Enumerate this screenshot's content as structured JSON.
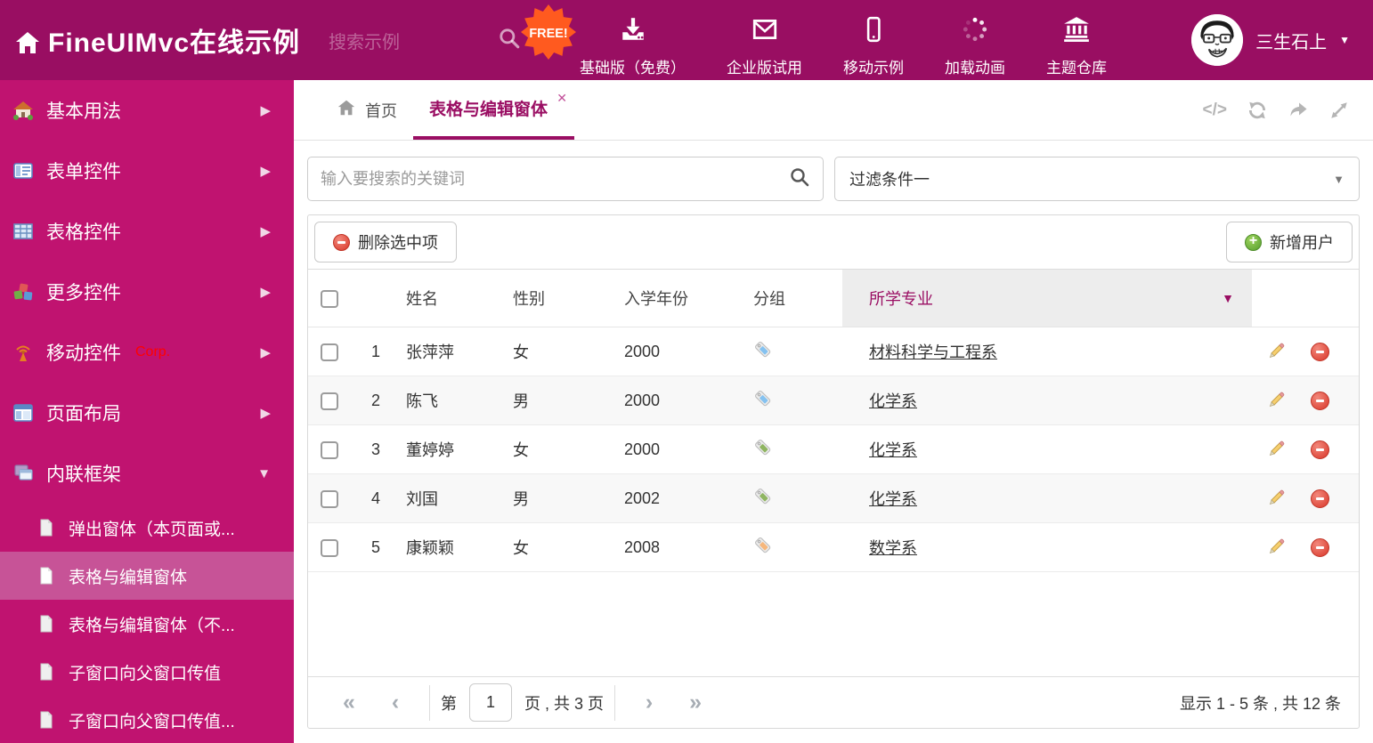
{
  "header": {
    "title": "FineUIMvc在线示例",
    "search_placeholder": "搜索示例",
    "free_badge": "FREE!",
    "nav_items": [
      {
        "icon": "download-icon",
        "label": "基础版（免费）"
      },
      {
        "icon": "envelope-icon",
        "label": "企业版试用"
      },
      {
        "icon": "mobile-icon",
        "label": "移动示例"
      },
      {
        "icon": "spinner-icon",
        "label": "加载动画"
      },
      {
        "icon": "bank-icon",
        "label": "主题仓库"
      }
    ],
    "username": "三生石上"
  },
  "sidebar": {
    "items": [
      {
        "label": "基本用法",
        "icon": "home-icon"
      },
      {
        "label": "表单控件",
        "icon": "form-icon"
      },
      {
        "label": "表格控件",
        "icon": "table-icon"
      },
      {
        "label": "更多控件",
        "icon": "blocks-icon"
      },
      {
        "label": "移动控件",
        "badge": "Corp.",
        "icon": "antenna-icon"
      },
      {
        "label": "页面布局",
        "icon": "layout-icon"
      },
      {
        "label": "内联框架",
        "icon": "frames-icon"
      }
    ],
    "subitems": [
      {
        "label": "弹出窗体（本页面或..."
      },
      {
        "label": "表格与编辑窗体"
      },
      {
        "label": "表格与编辑窗体（不..."
      },
      {
        "label": "子窗口向父窗口传值"
      },
      {
        "label": "子窗口向父窗口传值..."
      }
    ]
  },
  "tabs": {
    "home": "首页",
    "active": "表格与编辑窗体"
  },
  "filters": {
    "search_placeholder": "输入要搜索的关键词",
    "filter_label": "过滤条件一"
  },
  "toolbar": {
    "delete_label": "删除选中项",
    "add_label": "新增用户"
  },
  "table": {
    "columns": [
      "姓名",
      "性别",
      "入学年份",
      "分组",
      "所学专业"
    ],
    "rows": [
      {
        "num": "1",
        "name": "张萍萍",
        "gender": "女",
        "year": "2000",
        "tag": "blue",
        "tag_color": "#85c2f0",
        "major": "材料科学与工程系"
      },
      {
        "num": "2",
        "name": "陈飞",
        "gender": "男",
        "year": "2000",
        "tag": "blue",
        "tag_color": "#85c2f0",
        "major": "化学系"
      },
      {
        "num": "3",
        "name": "董婷婷",
        "gender": "女",
        "year": "2000",
        "tag": "green",
        "tag_color": "#8fb561",
        "major": "化学系"
      },
      {
        "num": "4",
        "name": "刘国",
        "gender": "男",
        "year": "2002",
        "tag": "green",
        "tag_color": "#8fb561",
        "major": "化学系"
      },
      {
        "num": "5",
        "name": "康颖颖",
        "gender": "女",
        "year": "2008",
        "tag": "orange",
        "tag_color": "#f6b77c",
        "major": "数学系"
      }
    ]
  },
  "pagination": {
    "page_prefix": "第",
    "current_page": "1",
    "page_suffix": "页 , 共 3 页",
    "summary": "显示 1 - 5 条 , 共 12 条"
  },
  "icons": {
    "chevron_right": "▶",
    "chevron_down": "▼",
    "caret_down": "▼",
    "close": "✕",
    "code": "</>",
    "first_page": "«",
    "prev_page": "‹",
    "next_page": "›",
    "last_page": "»"
  },
  "colors": {
    "header_bg": "#990e62",
    "sidebar_bg": "#c01370",
    "sidebar_selected": "#c75397",
    "accent": "#9a0e63",
    "free_badge": "#ff5a1f",
    "tag_blue": "#85c2f0",
    "tag_green": "#8fb561",
    "tag_orange": "#f6b77c"
  }
}
